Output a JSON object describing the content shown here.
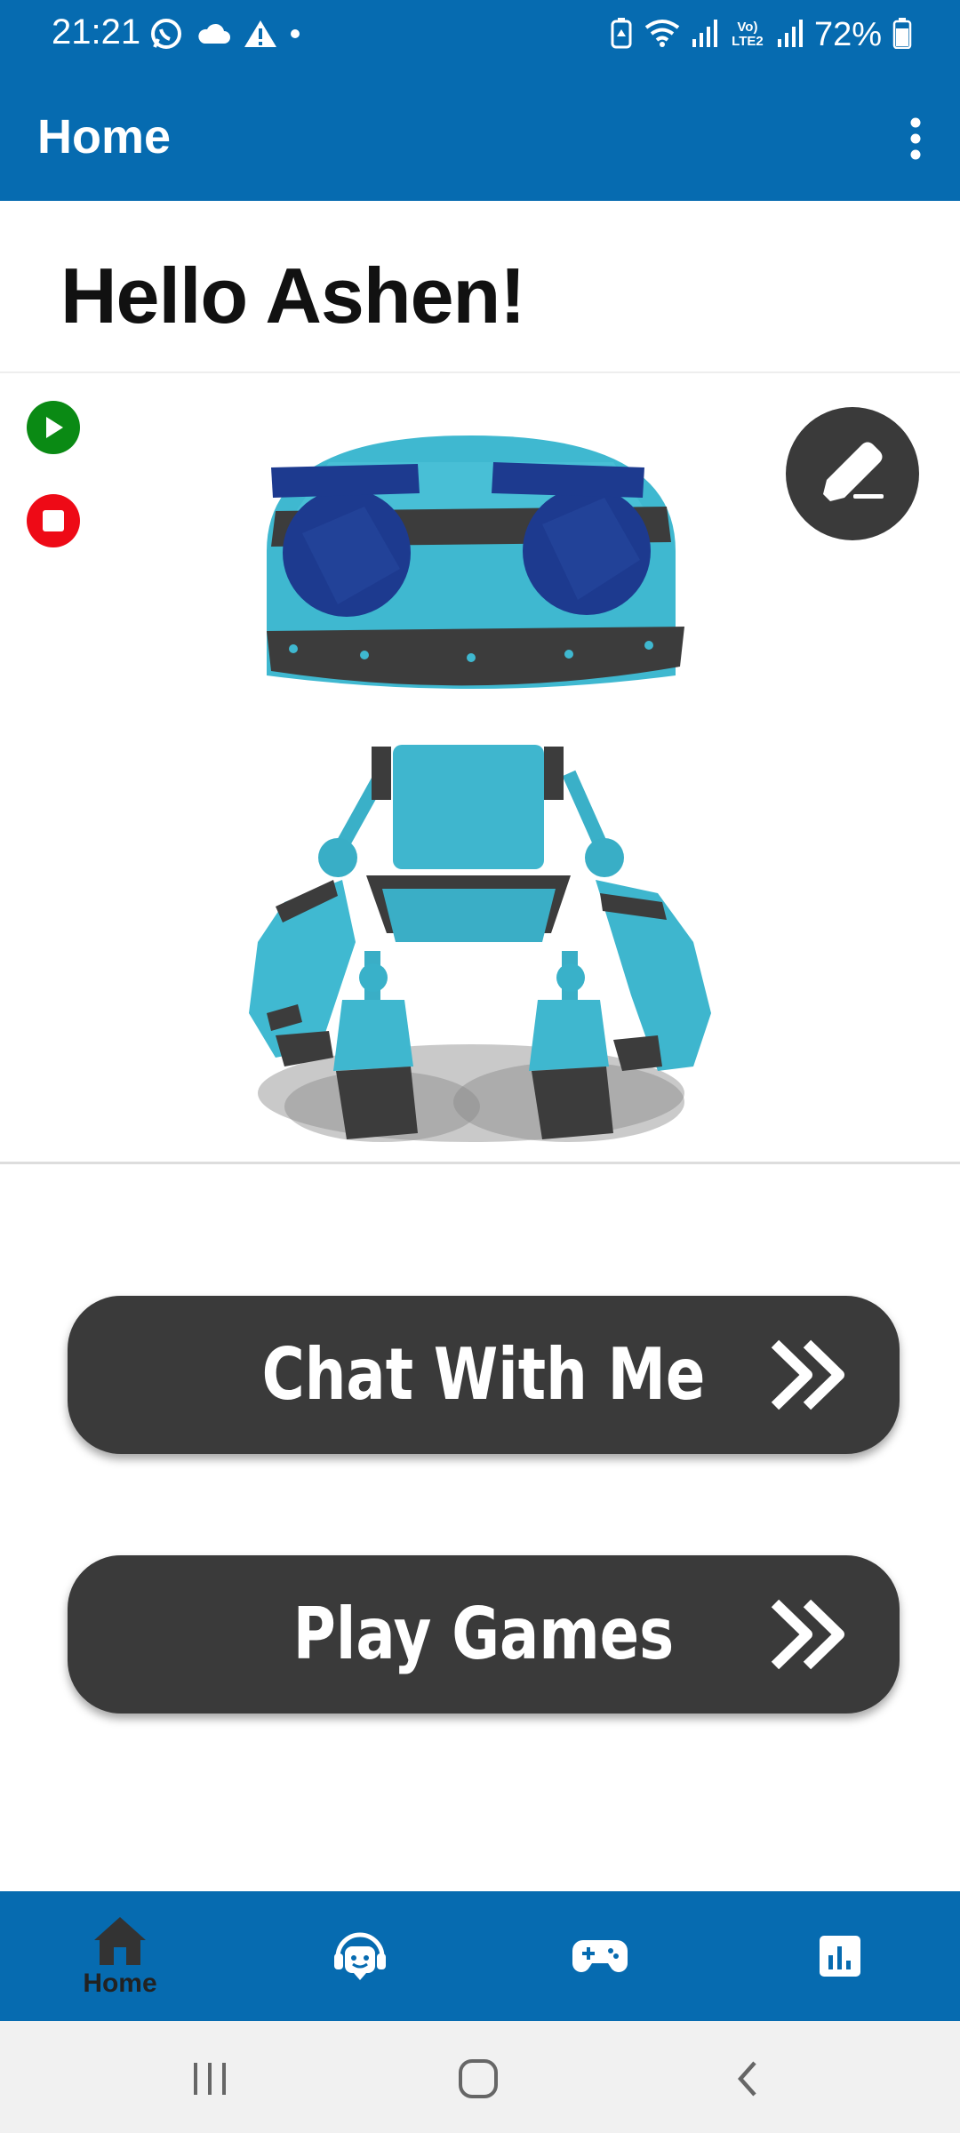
{
  "status_bar": {
    "time": "21:21",
    "left_icons": [
      "whatsapp-icon",
      "cloud-icon",
      "warning-icon",
      "dot-icon"
    ],
    "right_icons": [
      "battery-saver-icon",
      "wifi-icon",
      "signal-icon",
      "volte-icon",
      "signal-icon-2",
      "battery-icon"
    ],
    "network_label": "Vo) LTE2",
    "battery_percent": "72%"
  },
  "app_bar": {
    "title": "Home"
  },
  "greeting": {
    "text": "Hello Ashen!"
  },
  "viewer": {
    "controls": [
      "play-icon",
      "stop-icon",
      "pencil-icon"
    ]
  },
  "actions": {
    "chat_label": "Chat With Me",
    "games_label": "Play Games"
  },
  "bottom_nav": {
    "items": [
      {
        "icon": "home-icon",
        "label": "Home",
        "active": true
      },
      {
        "icon": "chat-bot-icon",
        "label": ""
      },
      {
        "icon": "gamepad-icon",
        "label": ""
      },
      {
        "icon": "stats-icon",
        "label": ""
      }
    ]
  },
  "system_nav": {
    "buttons": [
      "recents-icon",
      "home-circle-icon",
      "back-icon"
    ]
  },
  "colors": {
    "primary": "#066bb0",
    "button_dark": "#3a3a3a",
    "play_green": "#0a8a14",
    "stop_red": "#ee0a16",
    "robot_teal": "#3ab3cb",
    "robot_eye": "#1d3a8f"
  }
}
